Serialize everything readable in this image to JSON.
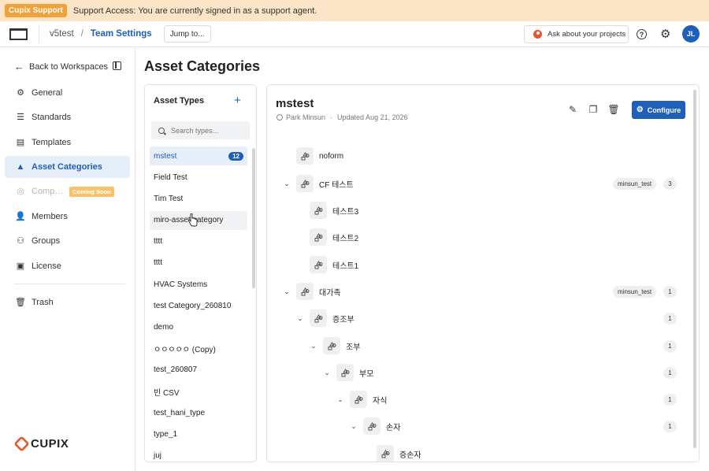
{
  "banner": {
    "badge": "Cupix Support",
    "text": "Support Access: You are currently signed in as a support agent."
  },
  "topbar": {
    "workspace": "v5test",
    "separator": "/",
    "current": "Team Settings",
    "jump_label": "Jump to...",
    "ask_label": "Ask about your projects",
    "help_glyph": "?",
    "avatar_initials": "JL"
  },
  "sidebar": {
    "back_label": "Back to Workspaces",
    "items": [
      {
        "label": "General",
        "icon": "gear-icon"
      },
      {
        "label": "Standards",
        "icon": "sliders-icon"
      },
      {
        "label": "Templates",
        "icon": "document-icon"
      },
      {
        "label": "Asset Categories",
        "icon": "shapes-icon"
      },
      {
        "label": "Compass",
        "icon": "compass-icon",
        "badge": "Coming Soon"
      },
      {
        "label": "Members",
        "icon": "user-icon"
      },
      {
        "label": "Groups",
        "icon": "group-icon"
      },
      {
        "label": "License",
        "icon": "license-icon"
      },
      {
        "label": "Trash",
        "icon": "trash-icon"
      }
    ],
    "logo_text": "CUPIX"
  },
  "page": {
    "title": "Asset Categories"
  },
  "types": {
    "header": "Asset Types",
    "search_placeholder": "Search types...",
    "list": [
      {
        "name": "mstest",
        "count": "12"
      },
      {
        "name": "Field Test"
      },
      {
        "name": "Tim Test"
      },
      {
        "name": "miro-asset-category"
      },
      {
        "name": "tttt"
      },
      {
        "name": "tttt"
      },
      {
        "name": "HVAC Systems"
      },
      {
        "name": "test Category_260810"
      },
      {
        "name": "demo"
      },
      {
        "name": "ㅇㅇㅇㅇㅇ (Copy)"
      },
      {
        "name": "test_260807"
      },
      {
        "name": "빈 CSV"
      },
      {
        "name": "test_hani_type"
      },
      {
        "name": "type_1"
      },
      {
        "name": "juj"
      }
    ]
  },
  "detail": {
    "title": "mstest",
    "author": "Park Minsun",
    "updated": "Updated Aug 21, 2026",
    "configure_label": "Configure",
    "tree": [
      {
        "label": "noform",
        "level": 0,
        "chevron": false
      },
      {
        "label": "CF 테스트",
        "level": 0,
        "chevron": true,
        "tag": "minsun_test",
        "count": "3"
      },
      {
        "label": "테스트3",
        "level": 1,
        "chevron": false
      },
      {
        "label": "테스트2",
        "level": 1,
        "chevron": false
      },
      {
        "label": "테스트1",
        "level": 1,
        "chevron": false
      },
      {
        "label": "대가족",
        "level": 0,
        "chevron": true,
        "tag": "minsun_test",
        "count": "1"
      },
      {
        "label": "증조부",
        "level": 1,
        "chevron": true,
        "count": "1"
      },
      {
        "label": "조부",
        "level": 2,
        "chevron": true,
        "count": "1"
      },
      {
        "label": "부모",
        "level": 3,
        "chevron": true,
        "count": "1"
      },
      {
        "label": "자식",
        "level": 4,
        "chevron": true,
        "count": "1"
      },
      {
        "label": "손자",
        "level": 5,
        "chevron": true,
        "count": "1"
      },
      {
        "label": "증손자",
        "level": 6,
        "chevron": false
      }
    ]
  },
  "colors": {
    "accent": "#1e5fb9",
    "banner_bg": "#fbe5c6",
    "support_badge": "#f0a23a",
    "coming_soon": "#f8c26a"
  }
}
